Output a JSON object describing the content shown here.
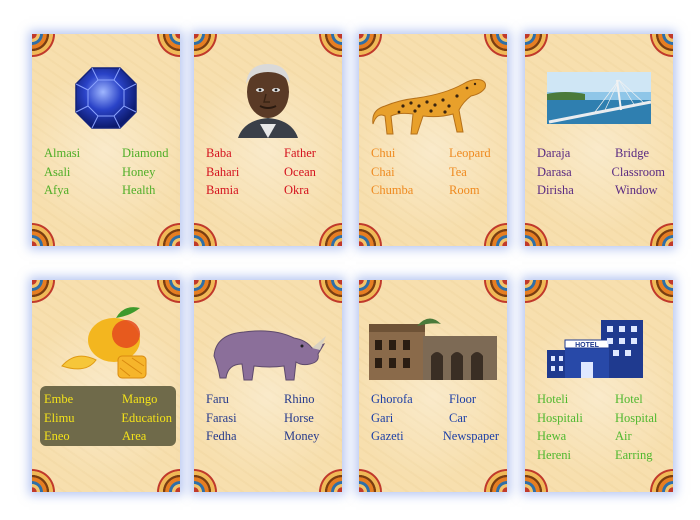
{
  "cards": [
    {
      "image": "sapphire-gem-icon",
      "color": "#4fae27",
      "words": [
        {
          "sw": "Almasi",
          "en": "Diamond"
        },
        {
          "sw": "Asali",
          "en": "Honey"
        },
        {
          "sw": "Afya",
          "en": "Health"
        }
      ]
    },
    {
      "image": "man-portrait",
      "color": "#d4111d",
      "words": [
        {
          "sw": "Baba",
          "en": "Father"
        },
        {
          "sw": "Bahari",
          "en": "Ocean"
        },
        {
          "sw": "Bamia",
          "en": "Okra"
        }
      ]
    },
    {
      "image": "leopard-icon",
      "color": "#ef8a1f",
      "words": [
        {
          "sw": "Chui",
          "en": "Leopard"
        },
        {
          "sw": "Chai",
          "en": "Tea"
        },
        {
          "sw": "Chumba",
          "en": "Room"
        }
      ]
    },
    {
      "image": "bridge-photo",
      "color": "#5a2a82",
      "words": [
        {
          "sw": "Daraja",
          "en": "Bridge"
        },
        {
          "sw": "Darasa",
          "en": "Classroom"
        },
        {
          "sw": "Dirisha",
          "en": "Window"
        }
      ]
    },
    {
      "image": "mango-icon",
      "color": "#f3e21a",
      "words": [
        {
          "sw": "Embe",
          "en": "Mango"
        },
        {
          "sw": "Elimu",
          "en": "Education"
        },
        {
          "sw": "Eneo",
          "en": "Area"
        }
      ]
    },
    {
      "image": "rhino-icon",
      "color": "#263a8c",
      "words": [
        {
          "sw": "Faru",
          "en": "Rhino"
        },
        {
          "sw": "Farasi",
          "en": "Horse"
        },
        {
          "sw": "Fedha",
          "en": "Money"
        }
      ]
    },
    {
      "image": "stone-building-photo",
      "color": "#1d3fa6",
      "words": [
        {
          "sw": "Ghorofa",
          "en": "Floor"
        },
        {
          "sw": "Gari",
          "en": "Car"
        },
        {
          "sw": "Gazeti",
          "en": "Newspaper"
        }
      ]
    },
    {
      "image": "hotel-icon",
      "color": "#4fb82e",
      "sign": "HOTEL",
      "words": [
        {
          "sw": "Hoteli",
          "en": "Hotel"
        },
        {
          "sw": "Hospitali",
          "en": "Hospital"
        },
        {
          "sw": "Hewa",
          "en": "Air"
        },
        {
          "sw": "Hereni",
          "en": "Earring"
        }
      ]
    }
  ]
}
